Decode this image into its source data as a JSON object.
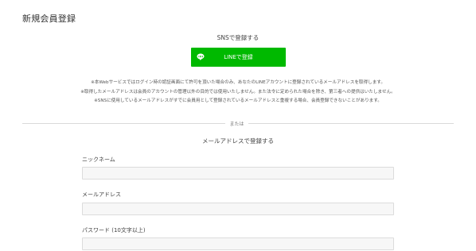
{
  "page": {
    "title": "新規会員登録"
  },
  "sns": {
    "heading": "SNSで登録する",
    "line_button_label": "LINEで登録",
    "line_icon": "line-chat-bubble-icon",
    "line_color": "#00b900"
  },
  "notes": [
    "※本Webサービスではログイン時の認証画面にて許可を頂いた場合のみ、あなたのLINEアカウントに登録されているメールアドレスを取得します。",
    "※取得したメールアドレスは会員のアカウントの管理以外の目的では使用いたしません。また法令に定められた場合を除き、第三者への提供はいたしません。",
    "※SNSに使用しているメールアドレスがすでに会員用として登録されているメールアドレスと重複する場合、会員登録できないことがあります。"
  ],
  "divider": {
    "text": "または"
  },
  "email_section": {
    "heading": "メールアドレスで登録する"
  },
  "fields": {
    "nickname": {
      "label": "ニックネーム",
      "value": "",
      "placeholder": ""
    },
    "email": {
      "label": "メールアドレス",
      "value": "",
      "placeholder": ""
    },
    "password": {
      "label": "パスワード (10文字以上)",
      "value": "",
      "placeholder": ""
    }
  }
}
